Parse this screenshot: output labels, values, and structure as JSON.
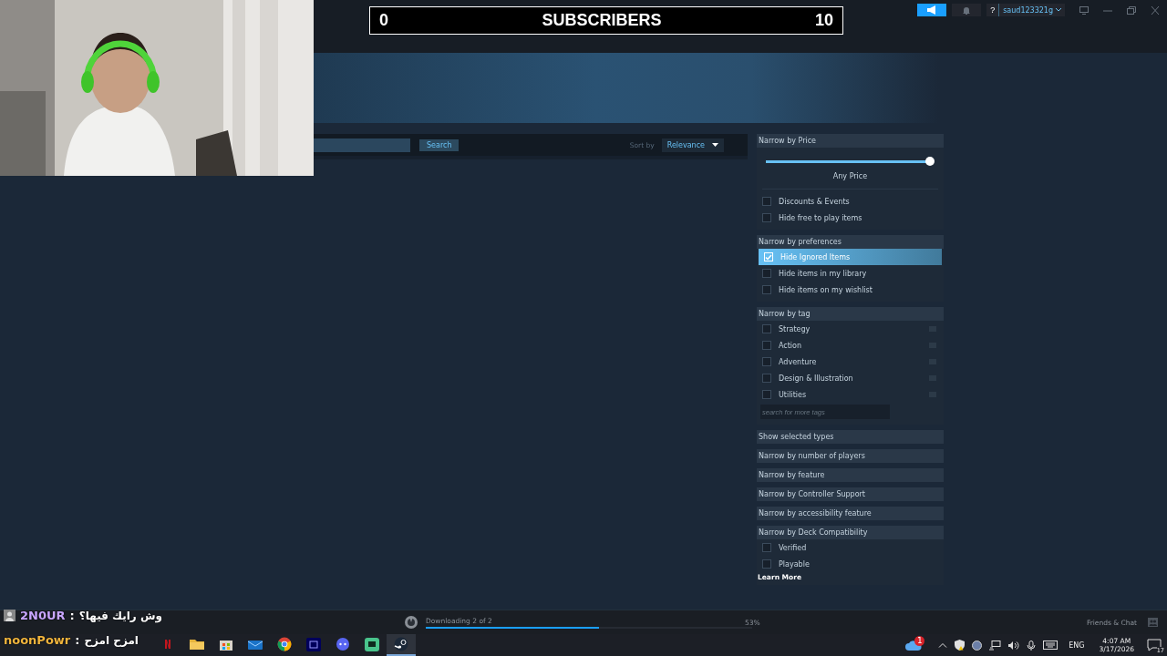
{
  "overlay": {
    "subscribers": {
      "current": "0",
      "label": "SUBSCRIBERS",
      "goal": "10"
    },
    "chat": [
      {
        "user": "2N0UR",
        "color": "#c9a6ff",
        "separator": ":",
        "message": "وش رايك فيها؟"
      },
      {
        "user": "noonPowr",
        "color": "#f0b43c",
        "separator": ":",
        "message": "امزح امزح"
      }
    ]
  },
  "titlebar": {
    "help": "?",
    "username": "saud123321g"
  },
  "store": {
    "search_button": "Search",
    "sort_label": "Sort by",
    "sort_value": "Relevance"
  },
  "filters": [
    {
      "kind": "price",
      "title": "Narrow by Price",
      "level": 1,
      "reading": "Any Price",
      "options": [
        {
          "label": "Discounts & Events",
          "checked": false,
          "highlighted": false
        },
        {
          "label": "Hide free to play items",
          "checked": false,
          "highlighted": false
        }
      ]
    },
    {
      "kind": "checklist",
      "title": "Narrow by preferences",
      "options": [
        {
          "label": "Hide Ignored Items",
          "checked": true,
          "highlighted": true
        },
        {
          "label": "Hide items in my library",
          "checked": false,
          "highlighted": false
        },
        {
          "label": "Hide items on my wishlist",
          "checked": false,
          "highlighted": false
        }
      ]
    },
    {
      "kind": "tags",
      "title": "Narrow by tag",
      "placeholder": "search for more tags",
      "options": [
        {
          "label": "Strategy",
          "checked": false,
          "highlighted": false
        },
        {
          "label": "Action",
          "checked": false,
          "highlighted": false
        },
        {
          "label": "Adventure",
          "checked": false,
          "highlighted": false
        },
        {
          "label": "Design & Illustration",
          "checked": false,
          "highlighted": false
        },
        {
          "label": "Utilities",
          "checked": false,
          "highlighted": false
        }
      ]
    },
    {
      "kind": "collapsed",
      "title": "Show selected types"
    },
    {
      "kind": "collapsed",
      "title": "Narrow by number of players"
    },
    {
      "kind": "collapsed",
      "title": "Narrow by feature"
    },
    {
      "kind": "collapsed",
      "title": "Narrow by Controller Support"
    },
    {
      "kind": "collapsed",
      "title": "Narrow by accessibility feature"
    },
    {
      "kind": "checklist",
      "title": "Narrow by Deck Compatibility",
      "link": "Learn More",
      "options": [
        {
          "label": "Verified",
          "checked": false,
          "highlighted": false
        },
        {
          "label": "Playable",
          "checked": false,
          "highlighted": false
        }
      ]
    }
  ],
  "bottom_bar": {
    "download": "Downloading 2 of 2",
    "level": 0.53,
    "percent": "53%",
    "friends": "Friends & Chat"
  },
  "taskbar": {
    "apps": [
      {
        "kind": "netflix",
        "selected": false
      },
      {
        "kind": "folder",
        "selected": false
      },
      {
        "kind": "store",
        "selected": false
      },
      {
        "kind": "mail",
        "selected": false
      },
      {
        "kind": "chrome",
        "selected": false
      },
      {
        "kind": "premiere",
        "selected": false
      },
      {
        "kind": "discord",
        "selected": false
      },
      {
        "kind": "chat",
        "selected": false
      },
      {
        "kind": "steam",
        "selected": true
      }
    ],
    "cloud_badge": "1",
    "language": "ENG",
    "time": "4:07 AM",
    "date": "3/17/2026",
    "notifications": "17"
  }
}
